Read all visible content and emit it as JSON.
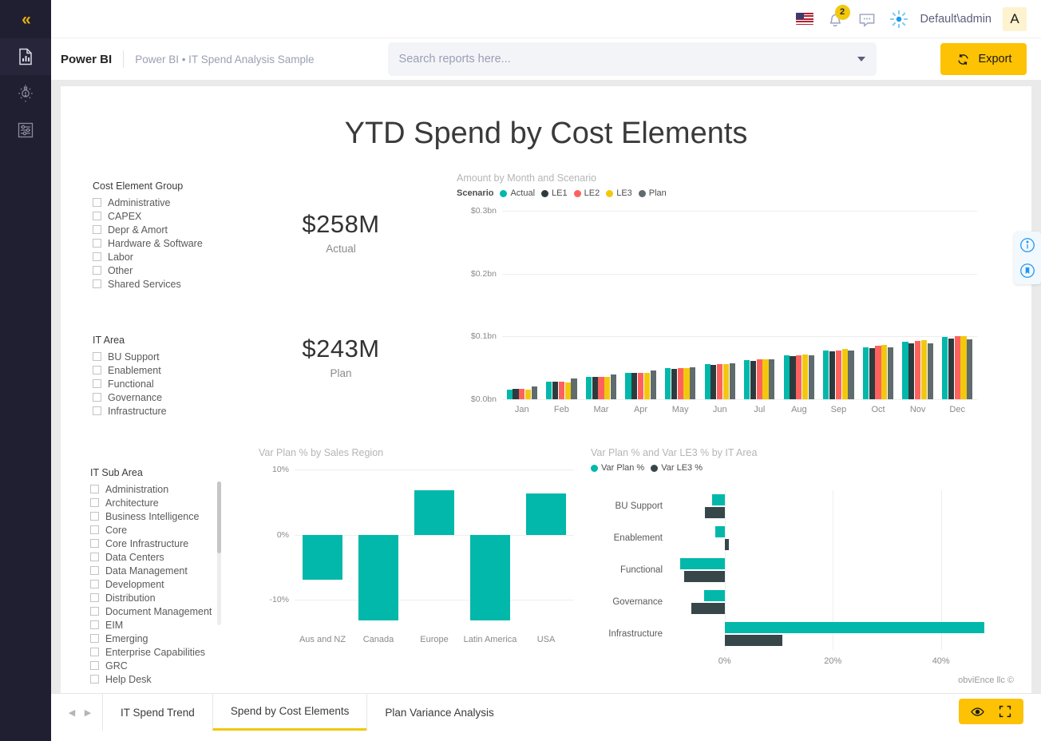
{
  "rail": {
    "collapse_label": "«",
    "items": [
      {
        "name": "reports",
        "icon": "report-document-icon"
      },
      {
        "name": "insights",
        "icon": "lightbulb-icon"
      },
      {
        "name": "settings",
        "icon": "sliders-icon"
      }
    ]
  },
  "topbar": {
    "flag": "us-flag-icon",
    "notification_count": "2",
    "username": "Default\\admin",
    "avatar_initial": "A"
  },
  "header": {
    "brand": "Power BI",
    "breadcrumb": "Power BI • IT Spend Analysis Sample",
    "search_placeholder": "Search reports here...",
    "search_value": "",
    "export_label": "Export"
  },
  "report": {
    "title": "YTD Spend by Cost Elements",
    "credit": "obviEnce llc ©"
  },
  "slicers": [
    {
      "id": "cost-element-group",
      "title": "Cost Element Group",
      "items": [
        "Administrative",
        "CAPEX",
        "Depr & Amort",
        "Hardware & Software",
        "Labor",
        "Other",
        "Shared Services"
      ]
    },
    {
      "id": "it-area",
      "title": "IT Area",
      "items": [
        "BU Support",
        "Enablement",
        "Functional",
        "Governance",
        "Infrastructure"
      ]
    },
    {
      "id": "it-sub-area",
      "title": "IT Sub Area",
      "items": [
        "Administration",
        "Architecture",
        "Business Intelligence",
        "Core",
        "Core Infrastructure",
        "Data Centers",
        "Data Management",
        "Development",
        "Distribution",
        "Document Management",
        "EIM",
        "Emerging",
        "Enterprise Capabilities",
        "GRC",
        "Help Desk"
      ]
    }
  ],
  "kpis": [
    {
      "id": "actual",
      "value": "$258M",
      "label": "Actual"
    },
    {
      "id": "plan",
      "value": "$243M",
      "label": "Plan"
    }
  ],
  "chart_data": [
    {
      "id": "amount-by-month-and-scenario",
      "type": "bar",
      "title": "Amount by Month and Scenario",
      "legend_title": "Scenario",
      "legend_position": "top",
      "grid": true,
      "xlabel": "",
      "ylabel": "",
      "ylim": [
        0,
        0.3
      ],
      "ytick_labels": [
        "$0.0bn",
        "$0.1bn",
        "$0.2bn",
        "$0.3bn"
      ],
      "ytick_values": [
        0,
        0.1,
        0.2,
        0.3
      ],
      "categories": [
        "Jan",
        "Feb",
        "Mar",
        "Apr",
        "May",
        "Jun",
        "Jul",
        "Aug",
        "Sep",
        "Oct",
        "Nov",
        "Dec"
      ],
      "series": [
        {
          "name": "Actual",
          "color": "#01B8AA",
          "values": [
            0.0155,
            0.0275,
            0.0355,
            0.042,
            0.049,
            0.056,
            0.0625,
            0.07,
            0.0775,
            0.0825,
            0.091,
            0.0995
          ]
        },
        {
          "name": "LE1",
          "color": "#2E3B3E",
          "values": [
            0.016,
            0.0275,
            0.0355,
            0.0425,
            0.0483,
            0.055,
            0.0612,
            0.0688,
            0.0762,
            0.0818,
            0.0895,
            0.096
          ]
        },
        {
          "name": "LE2",
          "color": "#FD625E",
          "values": [
            0.016,
            0.0275,
            0.0353,
            0.042,
            0.049,
            0.056,
            0.063,
            0.0705,
            0.078,
            0.0848,
            0.0928,
            0.1
          ]
        },
        {
          "name": "LE3",
          "color": "#F2C80F",
          "values": [
            0.0155,
            0.0272,
            0.035,
            0.0418,
            0.049,
            0.0558,
            0.0632,
            0.0715,
            0.0795,
            0.0865,
            0.0945,
            0.101
          ]
        },
        {
          "name": "Plan",
          "color": "#5F6B6D",
          "values": [
            0.0205,
            0.033,
            0.04,
            0.0455,
            0.0512,
            0.0568,
            0.064,
            0.0705,
            0.0778,
            0.0825,
            0.0892,
            0.095
          ]
        }
      ]
    },
    {
      "id": "var-plan-pct-by-sales-region",
      "type": "bar",
      "title": "Var Plan % by Sales Region",
      "grid": true,
      "xlabel": "",
      "ylabel": "",
      "ylim": [
        -14.5,
        10
      ],
      "ytick_labels": [
        "10%",
        "0%",
        "-10%"
      ],
      "ytick_values": [
        10,
        0,
        -10
      ],
      "categories": [
        "Aus and NZ",
        "Canada",
        "Europe",
        "Latin America",
        "USA"
      ],
      "series": [
        {
          "name": "Var Plan %",
          "color": "#01B8AA",
          "values": [
            -6.9,
            -13.2,
            6.8,
            -13.2,
            6.3
          ]
        }
      ]
    },
    {
      "id": "var-plan-and-var-le3-by-it-area",
      "type": "bar",
      "orientation": "horizontal",
      "title": "Var Plan % and Var LE3 % by IT Area",
      "legend_position": "top",
      "grid": true,
      "xlabel": "",
      "ylabel": "",
      "xlim": [
        -10,
        52
      ],
      "xtick_labels": [
        "0%",
        "20%",
        "40%"
      ],
      "xtick_values": [
        0,
        20,
        40
      ],
      "categories": [
        "BU Support",
        "Enablement",
        "Functional",
        "Governance",
        "Infrastructure"
      ],
      "series": [
        {
          "name": "Var Plan %",
          "color": "#01B8AA",
          "values": [
            -2.3,
            -1.7,
            -8.3,
            -3.8,
            48.0
          ]
        },
        {
          "name": "Var LE3 %",
          "color": "#374649",
          "values": [
            -3.6,
            0.8,
            -7.5,
            -6.1,
            10.6
          ]
        }
      ]
    }
  ],
  "float_panel": [
    {
      "id": "info",
      "icon": "info-circle-icon"
    },
    {
      "id": "bookmark",
      "icon": "bookmark-circle-icon"
    }
  ],
  "tabs": {
    "prev_label": "◀",
    "next_label": "▶",
    "items": [
      {
        "label": "IT Spend Trend",
        "active": false
      },
      {
        "label": "Spend by Cost Elements",
        "active": true
      },
      {
        "label": "Plan Variance Analysis",
        "active": false
      }
    ]
  },
  "view_controls": [
    {
      "id": "view-eye",
      "icon": "eye-icon"
    },
    {
      "id": "fullscreen",
      "icon": "fullscreen-icon"
    }
  ]
}
